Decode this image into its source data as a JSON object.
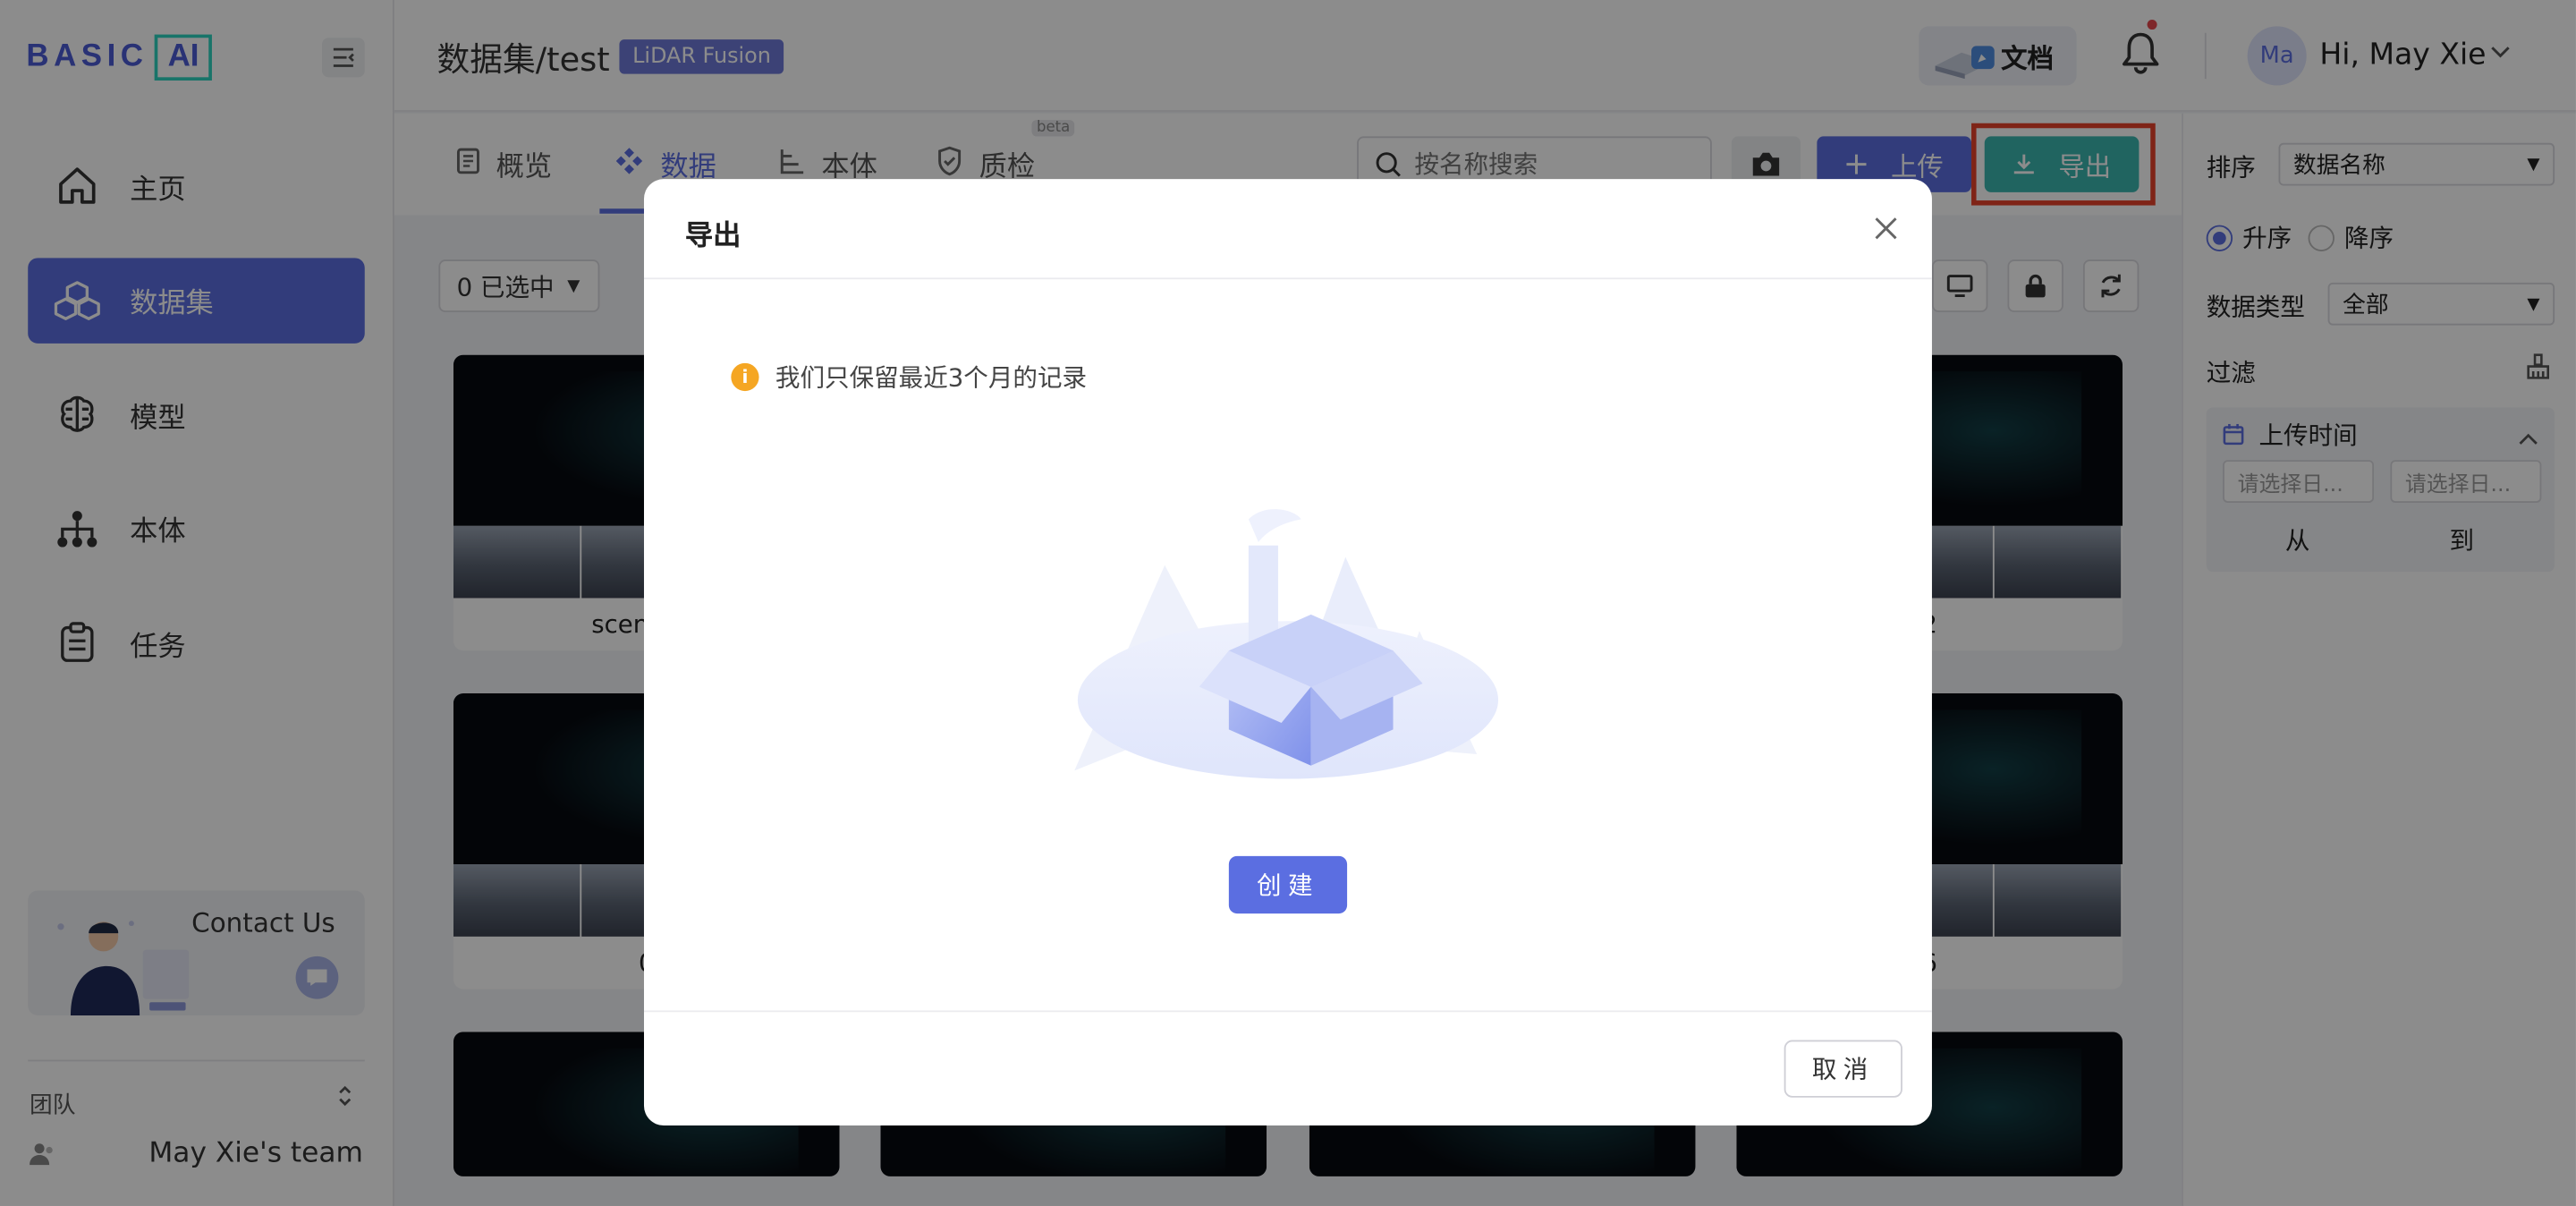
{
  "brand": {
    "logo_text": "BASIC",
    "logo_ai": "AI"
  },
  "sidebar": {
    "items": [
      {
        "label": "主页",
        "icon": "home-icon",
        "active": false
      },
      {
        "label": "数据集",
        "icon": "cubes-icon",
        "active": true
      },
      {
        "label": "模型",
        "icon": "brain-icon",
        "active": false
      },
      {
        "label": "本体",
        "icon": "hierarchy-icon",
        "active": false
      },
      {
        "label": "任务",
        "icon": "clipboard-icon",
        "active": false
      }
    ],
    "contact_label": "Contact Us",
    "team_label": "团队",
    "team_name": "May Xie's team"
  },
  "header": {
    "breadcrumb_root": "数据集",
    "breadcrumb_sep": "/",
    "breadcrumb_current": "test",
    "dataset_badge": "LiDAR Fusion",
    "docs_label": "文档",
    "avatar_initials": "Ma",
    "greeting": "Hi, May Xie"
  },
  "tabs": {
    "items": [
      {
        "label": "概览",
        "icon": "doc-icon"
      },
      {
        "label": "数据",
        "icon": "diamond-icon"
      },
      {
        "label": "本体",
        "icon": "tree-icon"
      },
      {
        "label": "质检",
        "icon": "shield-check-icon"
      }
    ],
    "active_index": 1,
    "beta_label": "beta",
    "search_placeholder": "按名称搜索",
    "upload_label": "上传",
    "export_label": "导出"
  },
  "toolbar": {
    "selected_count_label": "0 已选中"
  },
  "grid": {
    "cards": [
      {
        "name": "scene_0("
      },
      {
        "name": "2"
      },
      {
        "name": "0"
      },
      {
        "name": "6"
      },
      {
        "name": ""
      },
      {
        "name": ""
      },
      {
        "name": ""
      },
      {
        "name": ""
      }
    ]
  },
  "filters": {
    "sort_label": "排序",
    "sort_value": "数据名称",
    "asc_label": "升序",
    "desc_label": "降序",
    "order_selected": "asc",
    "type_label": "数据类型",
    "type_value": "全部",
    "filter_label": "过滤",
    "upload_time_label": "上传时间",
    "date_from_placeholder": "请选择日...",
    "date_to_placeholder": "请选择日...",
    "from_label": "从",
    "to_label": "到"
  },
  "modal": {
    "title": "导出",
    "notice": "我们只保留最近3个月的记录",
    "create_label": "创建",
    "cancel_label": "取消"
  },
  "colors": {
    "primary": "#5b6ee1",
    "export_teal": "#3bb6b0",
    "highlight_red": "#e8432b",
    "warning_orange": "#f5a623"
  }
}
